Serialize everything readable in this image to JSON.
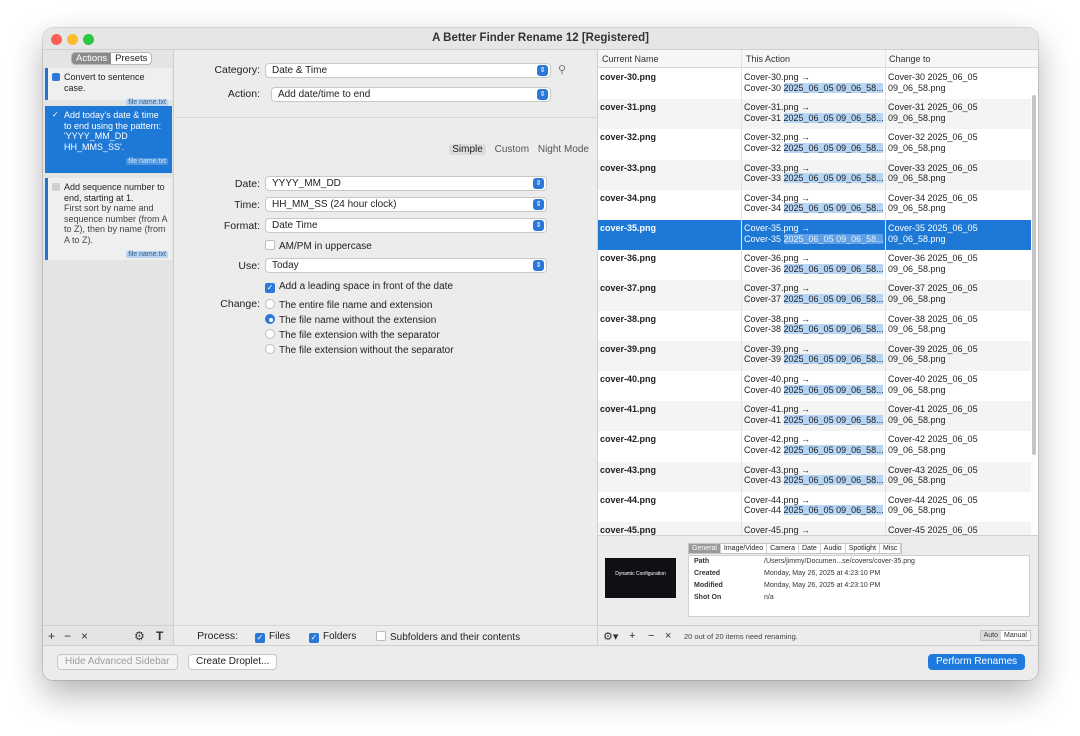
{
  "window": {
    "title": "A Better Finder Rename 12 [Registered]"
  },
  "sidebar": {
    "tabs": [
      "Actions",
      "Presets"
    ],
    "items": [
      {
        "title": "Convert to sentence case.",
        "desc": "",
        "badge": "file name.txt",
        "checked": true
      },
      {
        "title": "Add today's date & time to end using the pattern: 'YYYY_MM_DD HH_MMS_SS'.",
        "desc": "",
        "badge": "file name.txt",
        "checked": true
      },
      {
        "title": "Add sequence number to end, starting at 1.",
        "desc": "First sort by name and sequence number (from A to Z), then by name (from A to Z).",
        "badge": "file name.txt",
        "checked": false
      }
    ],
    "tools": [
      "+",
      "−",
      "×",
      "gear-icon",
      "text-add-icon"
    ]
  },
  "settings": {
    "category_label": "Category:",
    "category_value": "Date & Time",
    "action_label": "Action:",
    "action_value": "Add date/time to end",
    "modes": [
      "Simple",
      "Custom",
      "Night Mode"
    ],
    "date_label": "Date:",
    "date_value": "YYYY_MM_DD",
    "time_label": "Time:",
    "time_value": "HH_MM_SS (24 hour clock)",
    "format_label": "Format:",
    "format_value": "Date Time",
    "ampm_label": "AM/PM in uppercase",
    "ampm_checked": false,
    "use_label": "Use:",
    "use_value": "Today",
    "leading_space_label": "Add a leading space in front of the date",
    "leading_space_checked": true,
    "change_label": "Change:",
    "change_options": [
      "The entire file name and extension",
      "The file name without the extension",
      "The file extension with the separator",
      "The file extension without the separator"
    ],
    "change_selected_index": 1,
    "process_label": "Process:",
    "process_files": "Files",
    "process_folders": "Folders",
    "process_subfolders": "Subfolders and their contents"
  },
  "files": {
    "columns": [
      "Current Name",
      "This Action",
      "Change to"
    ],
    "rows": [
      {
        "current": "cover-30.png",
        "a1": "Cover-30.png →",
        "a2p": "Cover-30 ",
        "a2h": "2025_06_05 09_06_58...",
        "to1": "Cover-30 2025_06_05",
        "to2": "09_06_58.png"
      },
      {
        "current": "cover-31.png",
        "a1": "Cover-31.png →",
        "a2p": "Cover-31 ",
        "a2h": "2025_06_05 09_06_58...",
        "to1": "Cover-31 2025_06_05",
        "to2": "09_06_58.png"
      },
      {
        "current": "cover-32.png",
        "a1": "Cover-32.png →",
        "a2p": "Cover-32 ",
        "a2h": "2025_06_05 09_06_58...",
        "to1": "Cover-32 2025_06_05",
        "to2": "09_06_58.png"
      },
      {
        "current": "cover-33.png",
        "a1": "Cover-33.png →",
        "a2p": "Cover-33 ",
        "a2h": "2025_06_05 09_06_58...",
        "to1": "Cover-33 2025_06_05",
        "to2": "09_06_58.png"
      },
      {
        "current": "cover-34.png",
        "a1": "Cover-34.png →",
        "a2p": "Cover-34 ",
        "a2h": "2025_06_05 09_06_58...",
        "to1": "Cover-34 2025_06_05",
        "to2": "09_06_58.png"
      },
      {
        "current": "cover-35.png",
        "a1": "Cover-35.png →",
        "a2p": "Cover-35 ",
        "a2h": "2025_06_05 09_06_58...",
        "to1": "Cover-35 2025_06_05",
        "to2": "09_06_58.png"
      },
      {
        "current": "cover-36.png",
        "a1": "Cover-36.png →",
        "a2p": "Cover-36 ",
        "a2h": "2025_06_05 09_06_58...",
        "to1": "Cover-36 2025_06_05",
        "to2": "09_06_58.png"
      },
      {
        "current": "cover-37.png",
        "a1": "Cover-37.png →",
        "a2p": "Cover-37 ",
        "a2h": "2025_06_05 09_06_58...",
        "to1": "Cover-37 2025_06_05",
        "to2": "09_06_58.png"
      },
      {
        "current": "cover-38.png",
        "a1": "Cover-38.png →",
        "a2p": "Cover-38 ",
        "a2h": "2025_06_05 09_06_58...",
        "to1": "Cover-38 2025_06_05",
        "to2": "09_06_58.png"
      },
      {
        "current": "cover-39.png",
        "a1": "Cover-39.png →",
        "a2p": "Cover-39 ",
        "a2h": "2025_06_05 09_06_58...",
        "to1": "Cover-39 2025_06_05",
        "to2": "09_06_58.png"
      },
      {
        "current": "cover-40.png",
        "a1": "Cover-40.png →",
        "a2p": "Cover-40 ",
        "a2h": "2025_06_05 09_06_58...",
        "to1": "Cover-40 2025_06_05",
        "to2": "09_06_58.png"
      },
      {
        "current": "cover-41.png",
        "a1": "Cover-41.png →",
        "a2p": "Cover-41 ",
        "a2h": "2025_06_05 09_06_58...",
        "to1": "Cover-41 2025_06_05",
        "to2": "09_06_58.png"
      },
      {
        "current": "cover-42.png",
        "a1": "Cover-42.png →",
        "a2p": "Cover-42 ",
        "a2h": "2025_06_05 09_06_58...",
        "to1": "Cover-42 2025_06_05",
        "to2": "09_06_58.png"
      },
      {
        "current": "cover-43.png",
        "a1": "Cover-43.png →",
        "a2p": "Cover-43 ",
        "a2h": "2025_06_05 09_06_58...",
        "to1": "Cover-43 2025_06_05",
        "to2": "09_06_58.png"
      },
      {
        "current": "cover-44.png",
        "a1": "Cover-44.png →",
        "a2p": "Cover-44 ",
        "a2h": "2025_06_05 09_06_58...",
        "to1": "Cover-44 2025_06_05",
        "to2": "09_06_58.png"
      },
      {
        "current": "cover-45.png",
        "a1": "Cover-45.png →",
        "a2p": "",
        "a2h": "",
        "to1": "Cover-45 2025_06_05",
        "to2": ""
      }
    ],
    "selected_index": 5
  },
  "info": {
    "tabs": [
      "General",
      "Image/Video",
      "Camera",
      "Date",
      "Audio",
      "Spotlight",
      "Misc"
    ],
    "thumb_title": "Dynamic Configuration",
    "rows": [
      {
        "key": "Path",
        "value": "/Users/jimmy/Documen...se/covers/cover-35.png"
      },
      {
        "key": "Created",
        "value": "Monday, May 26, 2025 at 4:23:10 PM"
      },
      {
        "key": "Modified",
        "value": "Monday, May 26, 2025 at 4:23:10 PM"
      },
      {
        "key": "Shot On",
        "value": "n/a"
      }
    ],
    "status": "20 out of 20 items need renaming.",
    "auto": "Auto",
    "manual": "Manual"
  },
  "footer": {
    "hide_sidebar": "Hide Advanced Sidebar",
    "create_droplet": "Create Droplet...",
    "perform": "Perform Renames"
  }
}
